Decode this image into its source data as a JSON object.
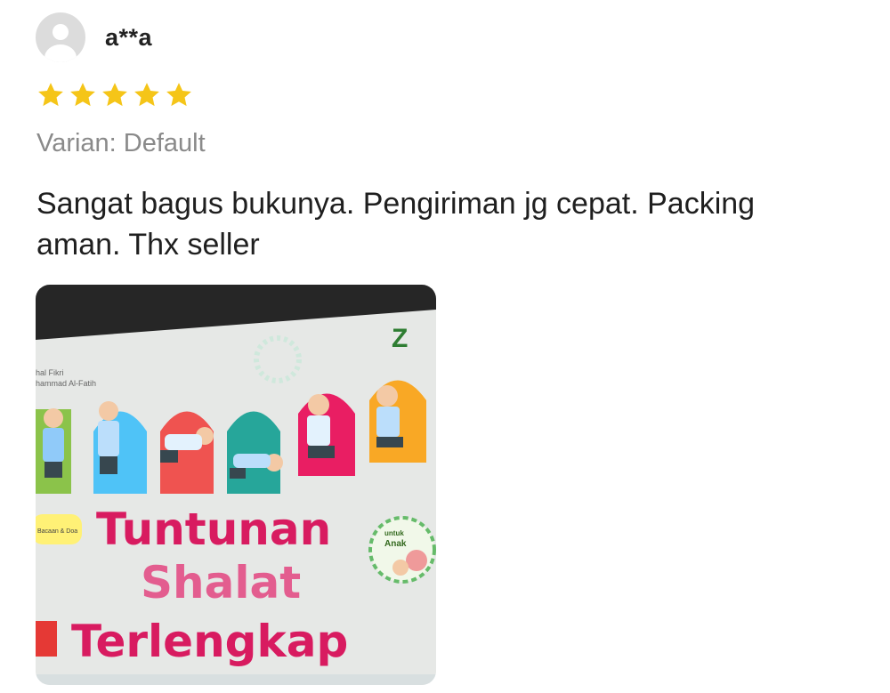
{
  "review": {
    "username": "a**a",
    "rating": 5,
    "rating_max": 5,
    "variant_label": "Varian: Default",
    "text": "Sangat bagus bukunya. Pengiriman jg cepat. Packing aman. Thx seller",
    "photo": {
      "book_authors": [
        "hal Fikri",
        "hammad Al-Fatih"
      ],
      "book_title_lines": [
        "Tuntunan",
        "Shalat",
        "Terlengkap"
      ],
      "publisher_mark": "Z",
      "badge_text": [
        "untuk",
        "Anak"
      ],
      "side_tag": "Bacaan & Doa"
    }
  },
  "colors": {
    "star": "#f5c518",
    "title_pink": "#d81b60",
    "avatar_bg": "#dcdcdc",
    "variant_gray": "#8a8a8a"
  }
}
